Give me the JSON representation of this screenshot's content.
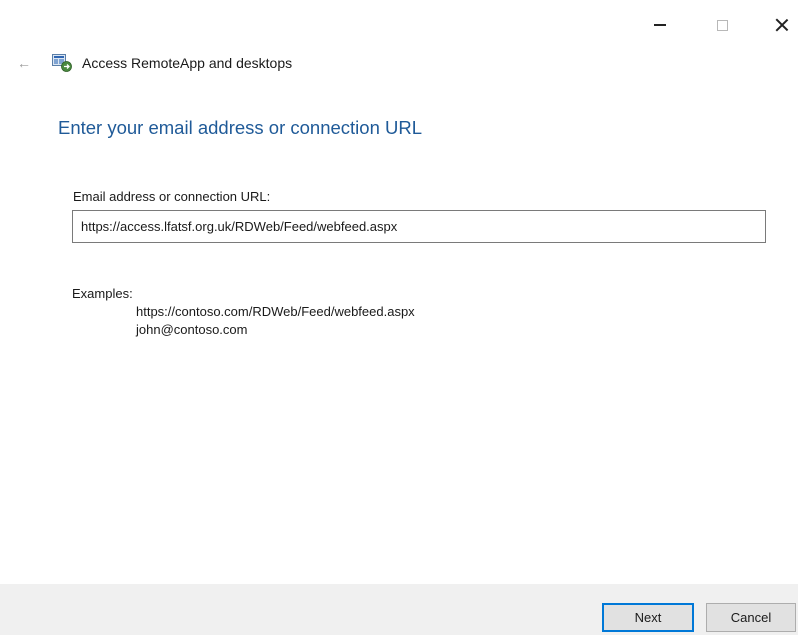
{
  "window": {
    "controls": {
      "minimize": "minimize-icon",
      "maximize": "maximize-icon",
      "close": "close-icon"
    }
  },
  "header": {
    "back_icon": "←",
    "app_icon": "remoteapp-icon",
    "title": "Access RemoteApp and desktops"
  },
  "main": {
    "heading": "Enter your email address or connection URL",
    "field_label": "Email address or connection URL:",
    "field_value": "https://access.lfatsf.org.uk/RDWeb/Feed/webfeed.aspx",
    "examples_label": "Examples:",
    "examples": [
      "https://contoso.com/RDWeb/Feed/webfeed.aspx",
      "john@contoso.com"
    ]
  },
  "footer": {
    "next_label": "Next",
    "cancel_label": "Cancel"
  },
  "colors": {
    "heading": "#1f5a98",
    "footer_bg": "#f0f0f0",
    "default_button_border": "#0078d7"
  }
}
